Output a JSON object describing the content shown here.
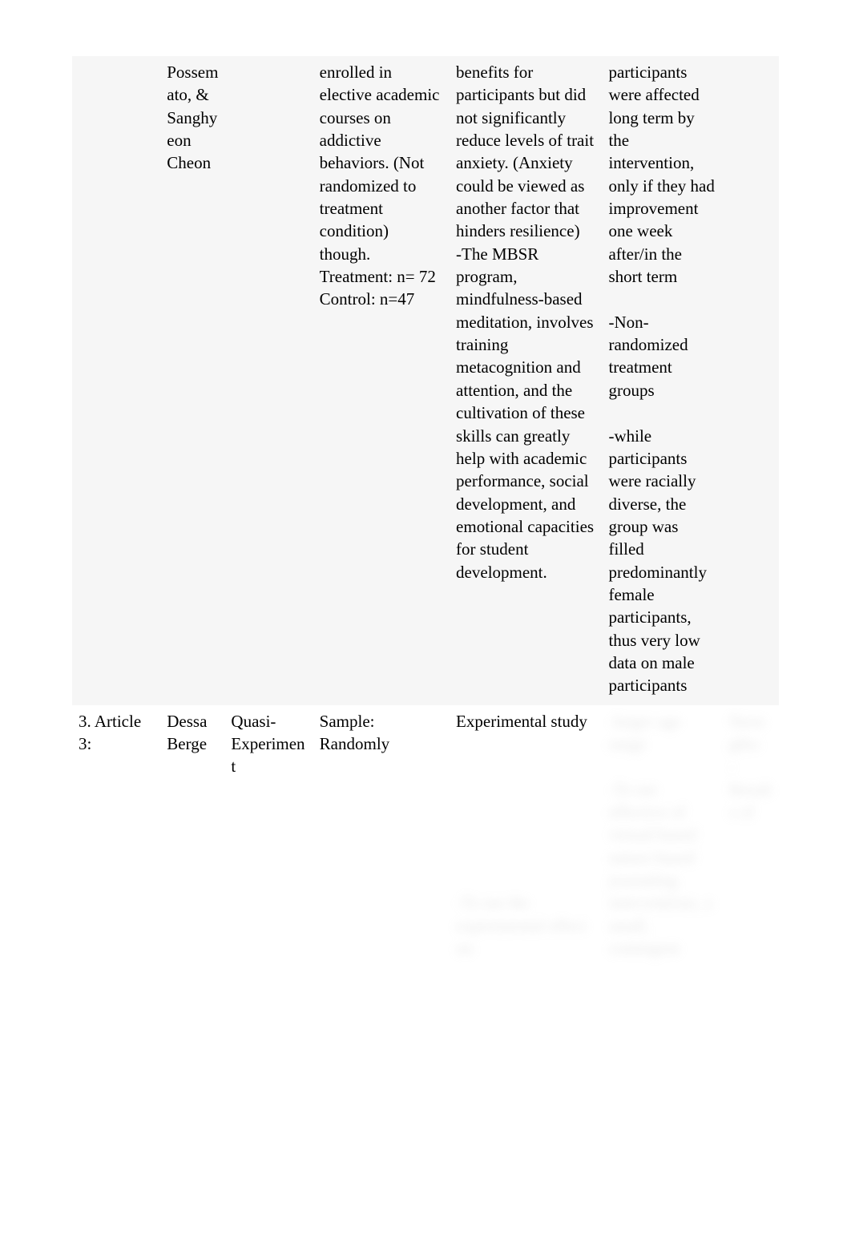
{
  "rows": [
    {
      "shaded": true,
      "cells": [
        "",
        "Possemato, & Sanghyeon Cheon",
        "",
        "enrolled in elective academic courses on addictive behaviors. (Not randomized to treatment condition) though. Treatment: n= 72\nControl: n=47",
        "benefits for participants but did not significantly reduce levels of trait anxiety. (Anxiety could be viewed as another factor that hinders resilience)\n-The MBSR program, mindfulness-based meditation, involves training metacognition and attention, and the cultivation of these skills can greatly help with academic performance, social development, and emotional capacities for student development.",
        "participants were affected long term by the intervention, only if they had improvement one week after/in the short term\n\n-Non-randomized treatment groups\n\n-while participants were racially diverse, the group was filled predominantly female participants, thus very low data on male participants",
        ""
      ],
      "blurred": [
        false,
        false,
        false,
        false,
        false,
        false,
        false
      ]
    },
    {
      "shaded": false,
      "cells": [
        "3. Article 3:",
        "Dessa Berge",
        "Quasi-Experiment",
        "Sample: Randomly",
        "Experimental study\n\n\n\n\n\n\n\n-To see the experimental effect on",
        "-larger age range\n\n-To see effective of virtual-based nature-based journaling interventions, a small, contingent",
        "Strengths:\n-Results of"
      ],
      "blurred": [
        false,
        false,
        false,
        false,
        true,
        true,
        true
      ]
    }
  ]
}
